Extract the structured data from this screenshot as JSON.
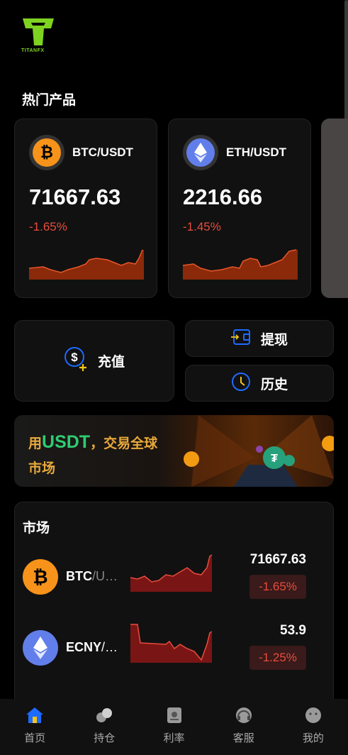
{
  "app": {
    "logo_text": "TITANFX"
  },
  "hot_products": {
    "title": "热门产品",
    "cards": [
      {
        "pair": "BTC/USDT",
        "price": "71667.63",
        "change": "-1.65%",
        "icon": "bitcoin-icon",
        "icon_color": "#f7931a"
      },
      {
        "pair": "ETH/USDT",
        "price": "2216.66",
        "change": "-1.45%",
        "icon": "ethereum-icon",
        "icon_color": "#627eea"
      }
    ]
  },
  "actions": {
    "deposit_label": "充值",
    "withdraw_label": "提现",
    "history_label": "历史"
  },
  "banner": {
    "prefix": "用",
    "highlight": "USDT",
    "suffix": "，交易全球",
    "line2": "市场"
  },
  "market": {
    "title": "市场",
    "rows": [
      {
        "base": "BTC",
        "quote": "/U…",
        "price": "71667.63",
        "change": "-1.65%",
        "icon": "bitcoin-icon",
        "icon_color": "#f7931a"
      },
      {
        "base": "ECNY",
        "quote": "/…",
        "price": "53.9",
        "change": "-1.25%",
        "icon": "ethereum-icon",
        "icon_color": "#627eea"
      }
    ]
  },
  "tabbar": {
    "items": [
      {
        "label": "首页",
        "icon": "home-icon",
        "active": true
      },
      {
        "label": "持仓",
        "icon": "coins-icon",
        "active": false
      },
      {
        "label": "利率",
        "icon": "rate-icon",
        "active": false
      },
      {
        "label": "客服",
        "icon": "support-icon",
        "active": false
      },
      {
        "label": "我的",
        "icon": "profile-icon",
        "active": false
      }
    ]
  },
  "colors": {
    "accent_blue": "#1e6bff",
    "down_red": "#e74c3c",
    "banner_gold": "#e8a93a",
    "banner_green": "#2ecc71"
  }
}
